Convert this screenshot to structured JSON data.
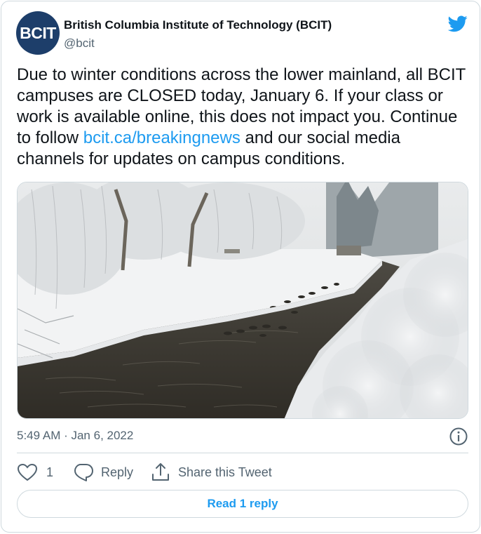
{
  "account": {
    "avatar_text": "BCIT",
    "name": "British Columbia Institute of Technology (BCIT)",
    "handle": "@bcit"
  },
  "tweet": {
    "text_before_link": "Due to winter conditions across the lower mainland, all BCIT campuses are CLOSED today, January 6. If your class or work is available online, this does not impact you. Continue to follow ",
    "link_text": "bcit.ca/breakingnews",
    "text_after_link": " and our social media channels for updates on campus conditions.",
    "timestamp": "5:49 AM · Jan 6, 2022"
  },
  "actions": {
    "like_count": "1",
    "reply_label": "Reply",
    "share_label": "Share this Tweet"
  },
  "read_replies_label": "Read 1 reply",
  "colors": {
    "brand_blue": "#1d9bf0",
    "avatar_navy": "#1d3e6a",
    "secondary_text": "#536471",
    "border": "#cfd9de"
  },
  "icons": [
    "twitter-bird-icon",
    "info-icon",
    "heart-icon",
    "reply-bubble-icon",
    "share-icon"
  ]
}
